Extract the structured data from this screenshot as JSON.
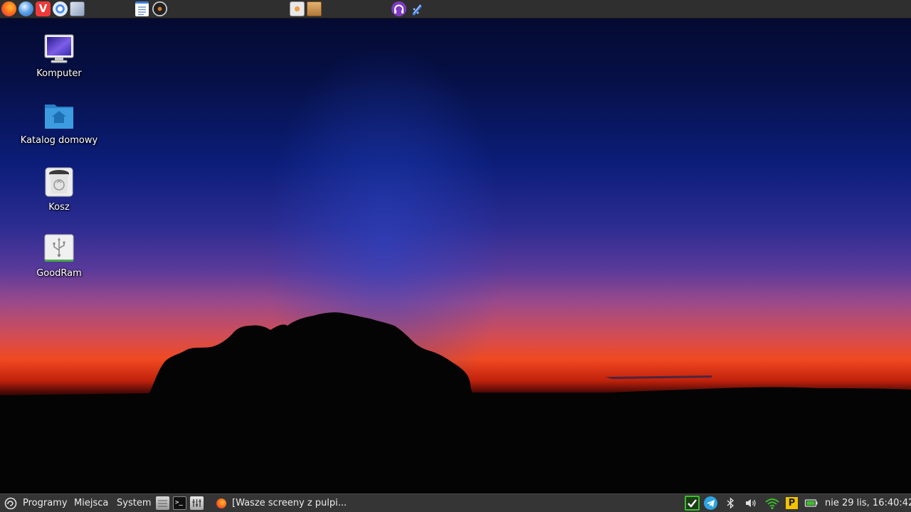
{
  "top_panel": {
    "launchers": [
      {
        "icon": "firefox-icon"
      },
      {
        "icon": "browser-globe-icon"
      },
      {
        "icon": "vivaldi-icon"
      },
      {
        "icon": "chromium-icon"
      },
      {
        "icon": "network-settings-icon"
      },
      {
        "icon": "text-document-icon"
      },
      {
        "icon": "media-player-icon"
      },
      {
        "icon": "image-viewer-icon"
      },
      {
        "icon": "archive-manager-icon"
      },
      {
        "icon": "headphones-icon"
      },
      {
        "icon": "bluetooth-transfer-icon"
      }
    ]
  },
  "desktop": {
    "icons": [
      {
        "label": "Komputer",
        "icon": "computer-icon"
      },
      {
        "label": "Katalog domowy",
        "icon": "home-folder-icon"
      },
      {
        "label": "Kosz",
        "icon": "trash-icon"
      },
      {
        "label": "GoodRam",
        "icon": "usb-drive-icon"
      }
    ]
  },
  "bottom_panel": {
    "menus": {
      "programy": "Programy",
      "miejsca": "Miejsca",
      "system": "System"
    },
    "task": {
      "title": "[Wasze screeny z pulpi..."
    },
    "clock": "nie 29 lis, 16:40:42"
  },
  "colors": {
    "panel_background": "#353535",
    "top_panel_background": "#2f2f2f",
    "panel_text": "#ececec",
    "update_ok_green": "#3cbf2c",
    "telegram_blue": "#2ca5e0",
    "folder_blue": "#2f8fd6"
  }
}
